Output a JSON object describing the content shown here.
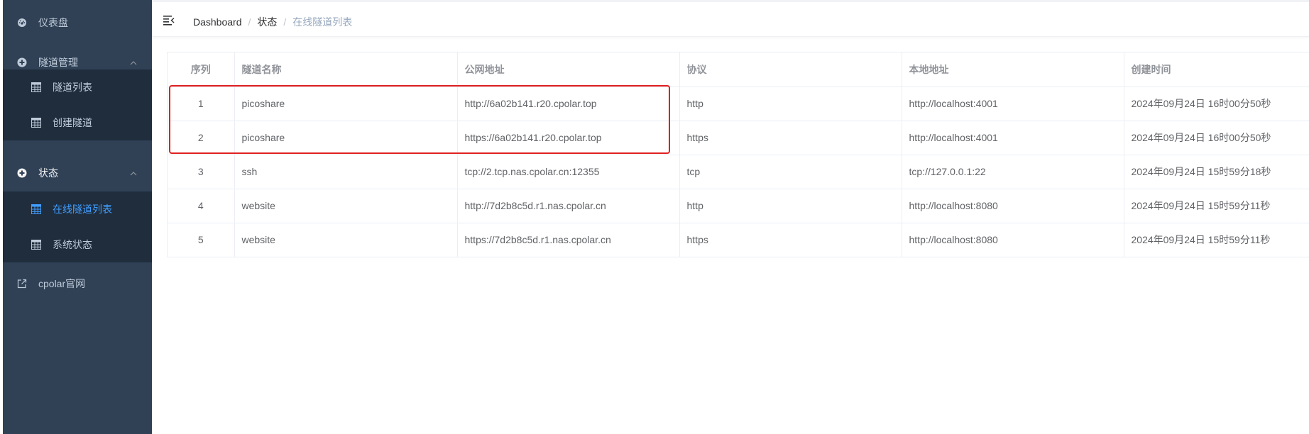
{
  "sidebar": {
    "dashboard": "仪表盘",
    "tunnel_mgmt": "隧道管理",
    "tunnel_list": "隧道列表",
    "create_tunnel": "创建隧道",
    "status": "状态",
    "online_tunnels": "在线隧道列表",
    "system_status": "系统状态",
    "official_site": "cpolar官网"
  },
  "breadcrumb": {
    "home": "Dashboard",
    "sep1": "/",
    "parent": "状态",
    "sep2": "/",
    "current": "在线隧道列表"
  },
  "table": {
    "headers": [
      "序列",
      "隧道名称",
      "公网地址",
      "协议",
      "本地地址",
      "创建时间"
    ],
    "rows": [
      [
        "1",
        "picoshare",
        "http://6a02b141.r20.cpolar.top",
        "http",
        "http://localhost:4001",
        "2024年09月24日 16时00分50秒"
      ],
      [
        "2",
        "picoshare",
        "https://6a02b141.r20.cpolar.top",
        "https",
        "http://localhost:4001",
        "2024年09月24日 16时00分50秒"
      ],
      [
        "3",
        "ssh",
        "tcp://2.tcp.nas.cpolar.cn:12355",
        "tcp",
        "tcp://127.0.0.1:22",
        "2024年09月24日 15时59分18秒"
      ],
      [
        "4",
        "website",
        "http://7d2b8c5d.r1.nas.cpolar.cn",
        "http",
        "http://localhost:8080",
        "2024年09月24日 15时59分11秒"
      ],
      [
        "5",
        "website",
        "https://7d2b8c5d.r1.nas.cpolar.cn",
        "https",
        "http://localhost:8080",
        "2024年09月24日 15时59分11秒"
      ]
    ]
  },
  "colors": {
    "sidebar_bg": "#304156",
    "submenu_bg": "#1f2d3d",
    "active": "#409eff",
    "highlight": "#e02020"
  }
}
